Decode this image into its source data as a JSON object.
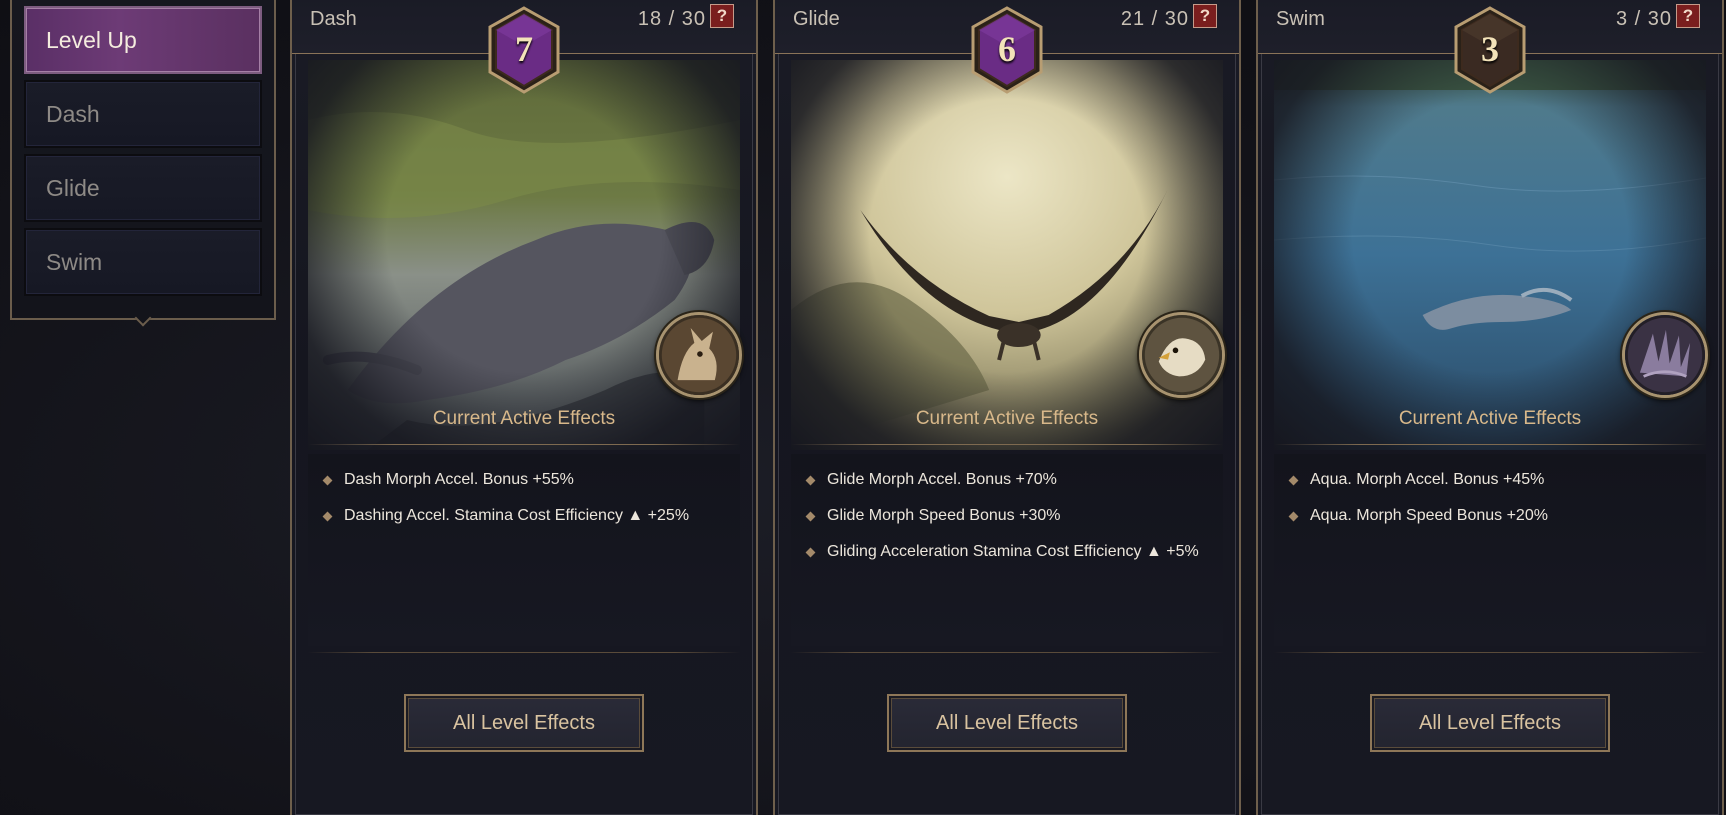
{
  "sidebar": {
    "items": [
      {
        "label": "Level Up",
        "active": true
      },
      {
        "label": "Dash",
        "active": false
      },
      {
        "label": "Glide",
        "active": false
      },
      {
        "label": "Swim",
        "active": false
      }
    ]
  },
  "cards": [
    {
      "title": "Dash",
      "count": "18 / 30",
      "level": "7",
      "badge_color": "#6a2c85",
      "effects_title": "Current Active Effects",
      "effects": [
        "Dash Morph Accel. Bonus +55%",
        "Dashing Accel. Stamina Cost Efficiency ▲ +25%"
      ],
      "button_label": "All Level Effects",
      "morph_icon": "jackal-icon"
    },
    {
      "title": "Glide",
      "count": "21 / 30",
      "level": "6",
      "badge_color": "#6a2c85",
      "effects_title": "Current Active Effects",
      "effects": [
        "Glide Morph Accel. Bonus +70%",
        "Glide Morph Speed Bonus  +30%",
        "Gliding Acceleration Stamina Cost Efficiency ▲ +5%"
      ],
      "button_label": "All Level Effects",
      "morph_icon": "eagle-icon"
    },
    {
      "title": "Swim",
      "count": "3 / 30",
      "level": "3",
      "badge_color": "#3a2a22",
      "effects_title": "Current Active Effects",
      "effects": [
        "Aqua. Morph Accel. Bonus +45%",
        "Aqua. Morph Speed Bonus +20%"
      ],
      "button_label": "All Level Effects",
      "morph_icon": "serpent-icon"
    }
  ],
  "help_label": "?"
}
